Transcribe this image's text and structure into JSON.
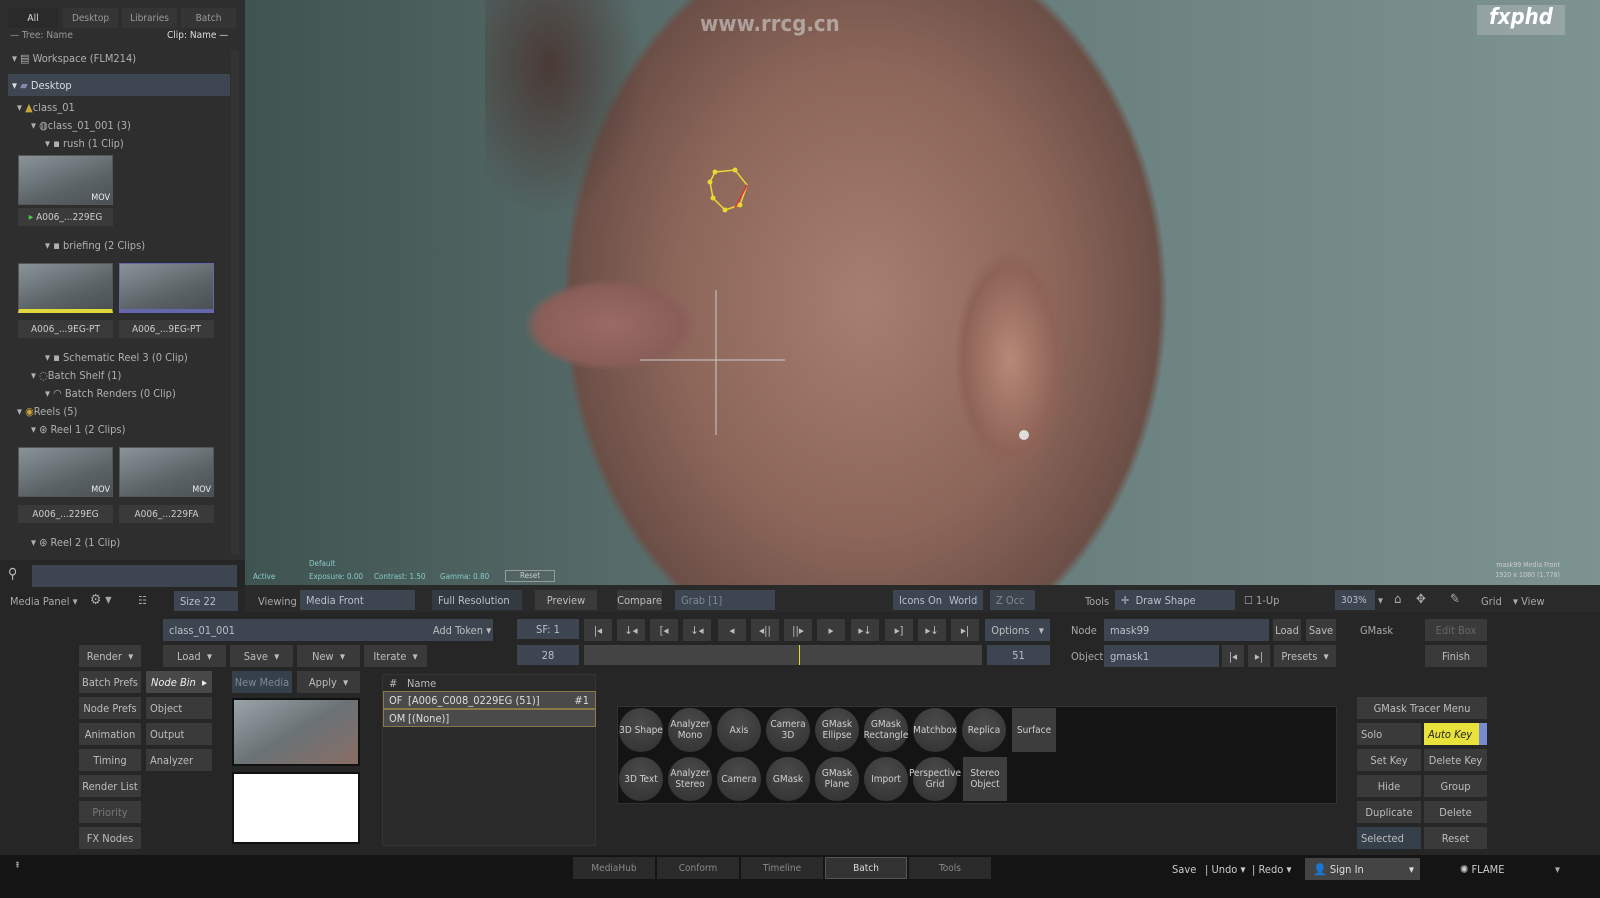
{
  "left_panel": {
    "tabs": [
      "All",
      "Desktop",
      "Libraries",
      "Batch"
    ],
    "tree_sort": "— Tree: Name",
    "clip_sort": "Clip: Name —",
    "tree": [
      "Workspace (FLM214)",
      "Desktop",
      "class_01",
      "class_01_001 (3)",
      "rush (1 Clip)",
      "briefing (2 Clips)",
      "Schematic Reel 3 (0 Clip)",
      "Batch Shelf (1)",
      "Batch Renders (0 Clip)",
      "Reels (5)",
      "Reel 1 (2 Clips)",
      "Reel 2 (1 Clip)"
    ],
    "clips": {
      "rush": "A006_...229EG",
      "briefing": [
        "A006_...9EG-PT",
        "A006_...9EG-PT"
      ],
      "reel1": [
        "A006_...229EG",
        "A006_...229FA"
      ]
    },
    "mov_badge": "MOV",
    "media_panel": "Media Panel",
    "size": "Size 22"
  },
  "viewer": {
    "watermark_url": "www.rrcg.cn",
    "logo": "fxphd",
    "active": "Active",
    "lut": "Default",
    "exposure": "Exposure: 0.00",
    "contrast": "Contrast: 1.50",
    "gamma": "Gamma: 0.80",
    "reset": "Reset",
    "info": "mask99 Media Front",
    "resolution": "1920 x 1080 (1.778)"
  },
  "toolbar": {
    "viewing": "Viewing",
    "media_front": "Media Front",
    "full_res": "Full Resolution",
    "preview": "Preview",
    "compare": "Compare",
    "grab": "Grab [1]",
    "icons_on": "Icons On",
    "world": "World",
    "z_occ": "Z Occ",
    "tools": "Tools",
    "draw_shape": "Draw Shape",
    "one_up": "1-Up",
    "zoom": "303%",
    "grid": "Grid",
    "view": "View"
  },
  "batch": {
    "name": "class_01_001",
    "add_token": "Add Token",
    "render": "Render",
    "load": "Load",
    "save": "Save",
    "new": "New",
    "iterate": "Iterate",
    "menu_left": [
      "Batch Prefs",
      "Node Prefs",
      "Animation",
      "Timing",
      "Render List",
      "Priority",
      "FX Nodes"
    ],
    "menu_right": [
      "Node Bin",
      "Object",
      "Output",
      "Analyzer"
    ],
    "new_media": "New Media",
    "apply": "Apply",
    "table_headers": [
      "#",
      "Name"
    ],
    "table_rows": [
      {
        "id": "OF",
        "name": "[A006_C008_0229EG (51)]",
        "tag": "#1"
      },
      {
        "id": "OM",
        "name": "[(None)]",
        "tag": ""
      }
    ]
  },
  "transport": {
    "start_frame": "SF: 1",
    "current": "28",
    "end": "51",
    "options": "Options",
    "playhead_fraction": 0.54
  },
  "node": {
    "node_label": "Node",
    "node_value": "mask99",
    "load": "Load",
    "save": "Save",
    "object_label": "Object",
    "object_value": "gmask1",
    "presets": "Presets",
    "gmask": "GMask",
    "edit_box": "Edit Box",
    "finish": "Finish"
  },
  "node_bin": {
    "row1": [
      "3D Shape",
      "Analyzer Mono",
      "Axis",
      "Camera 3D",
      "GMask Ellipse",
      "GMask Rectangle",
      "Matchbox",
      "Replica"
    ],
    "row1_square": "Surface",
    "row2": [
      "3D Text",
      "Analyzer Stereo",
      "Camera",
      "GMask",
      "GMask Plane",
      "Import",
      "Perspective Grid"
    ],
    "row2_square": "Stereo Object"
  },
  "gmask_menu": {
    "tracer": "GMask Tracer Menu",
    "solo": "Solo",
    "auto_key": "Auto Key",
    "set_key": "Set Key",
    "delete_key": "Delete Key",
    "hide": "Hide",
    "group": "Group",
    "duplicate": "Duplicate",
    "delete": "Delete",
    "selected": "Selected",
    "reset": "Reset",
    "accent": "#e8e23a"
  },
  "footer": {
    "tabs": [
      "MediaHub",
      "Conform",
      "Timeline",
      "Batch",
      "Tools"
    ],
    "active_tab": "Batch",
    "save": "Save",
    "undo": "Undo",
    "redo": "Redo",
    "sign_in": "Sign In",
    "app": "FLAME"
  }
}
